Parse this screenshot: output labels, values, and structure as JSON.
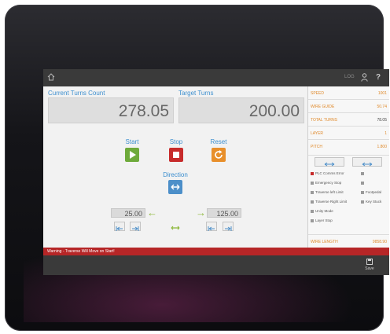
{
  "top_bar": {
    "icons": [
      "home-icon",
      "user-icon",
      "help-icon"
    ],
    "right_label": "LOG",
    "help_glyph": "?"
  },
  "counts": {
    "current_label": "Current Turns Count",
    "current_value": "278.05",
    "target_label": "Target Turns",
    "target_value": "200.00"
  },
  "controls": {
    "start_label": "Start",
    "stop_label": "Stop",
    "reset_label": "Reset",
    "direction_label": "Direction"
  },
  "traverse": {
    "left_value": "25.00",
    "right_value": "125.00"
  },
  "side_panel": {
    "rows": [
      {
        "key": "SPEED",
        "value": "1001"
      },
      {
        "key": "WIRE GUIDE",
        "value": "50.74"
      },
      {
        "key": "TOTAL TURNS",
        "value": "78.05"
      },
      {
        "key": "LAYER",
        "value": "1"
      },
      {
        "key": "PITCH",
        "value": "1.800"
      }
    ],
    "statuses": [
      {
        "label": "PLC Comms Error",
        "active": true
      },
      {
        "label": "Emergency Stop",
        "active": false
      },
      {
        "label": "Traverse left Limit",
        "active": false
      },
      {
        "label": "Traverse Right Limit",
        "active": false
      },
      {
        "label": "Unity Mode",
        "active": false
      },
      {
        "label": "Layer Stop",
        "active": false
      }
    ],
    "statuses_right": [
      {
        "label": "",
        "active": false
      },
      {
        "label": "",
        "active": false
      },
      {
        "label": "Footpedal",
        "active": false
      },
      {
        "label": "Key Stuck",
        "active": false
      }
    ],
    "wire_length_label": "WIRE LENGTH",
    "wire_length_value": "9858.90"
  },
  "warning": "Warning - Traverse Will Move on Start!",
  "bottom": {
    "save_label": "Save"
  },
  "colors": {
    "accent_blue": "#3d8fcf",
    "start_green": "#6eaa3b",
    "stop_red": "#c72b2b",
    "reset_orange": "#e88f2b",
    "warning_red": "#b62627"
  }
}
